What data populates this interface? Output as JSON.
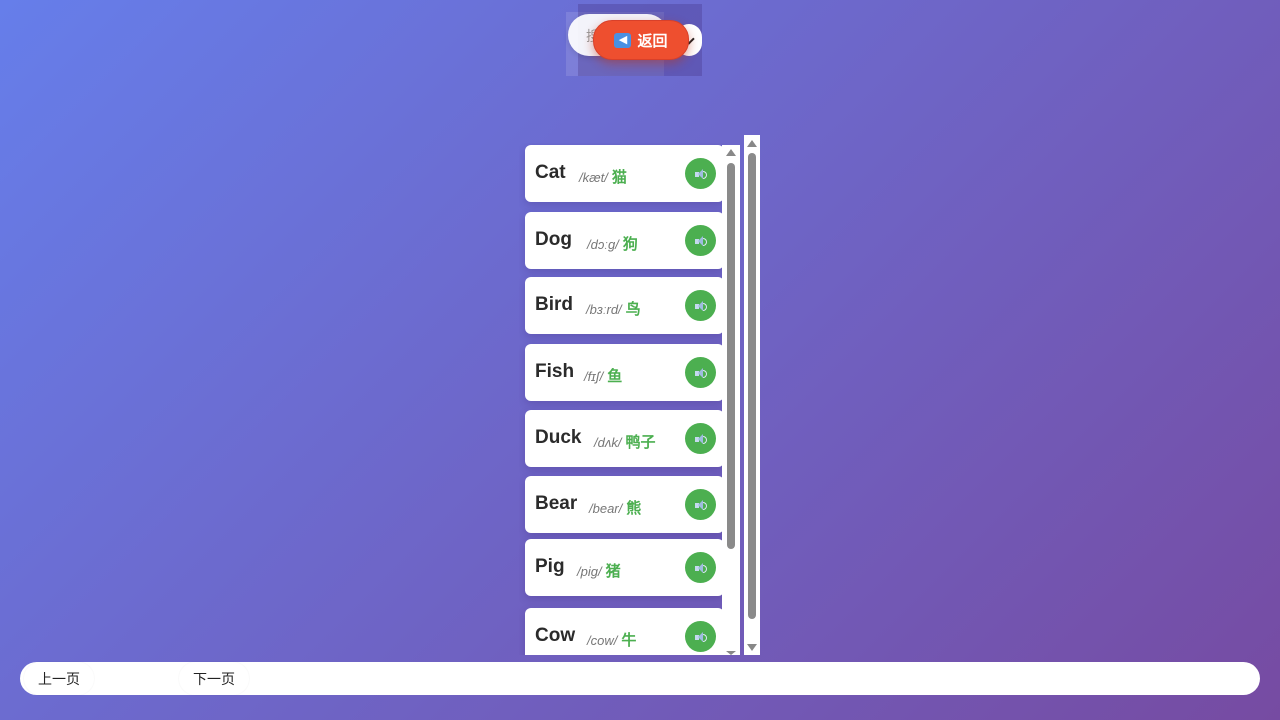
{
  "header": {
    "search_placeholder": "搜索单词",
    "back_label": "返回",
    "back_icon": "left-arrow-emoji-icon",
    "dropdown_icon": "chevron-down-icon"
  },
  "words": [
    {
      "word": "Cat",
      "phonetic": "/kæt/",
      "meaning": "猫"
    },
    {
      "word": "Dog",
      "phonetic": "/dɔːg/",
      "meaning": "狗"
    },
    {
      "word": "Bird",
      "phonetic": "/bɜːrd/",
      "meaning": "鸟"
    },
    {
      "word": "Fish",
      "phonetic": "/fɪʃ/",
      "meaning": "鱼"
    },
    {
      "word": "Duck",
      "phonetic": "/dʌk/",
      "meaning": "鸭子"
    },
    {
      "word": "Bear",
      "phonetic": "/bear/",
      "meaning": "熊"
    },
    {
      "word": "Pig",
      "phonetic": "/pig/",
      "meaning": "猪"
    },
    {
      "word": "Cow",
      "phonetic": "/cow/",
      "meaning": "牛"
    }
  ],
  "pagination": {
    "prev_label": "上一页",
    "next_label": "下一页"
  },
  "colors": {
    "accent_green": "#4caf50",
    "back_button": "#ee4f2f",
    "background_start": "#667eea",
    "background_end": "#764ba2"
  }
}
